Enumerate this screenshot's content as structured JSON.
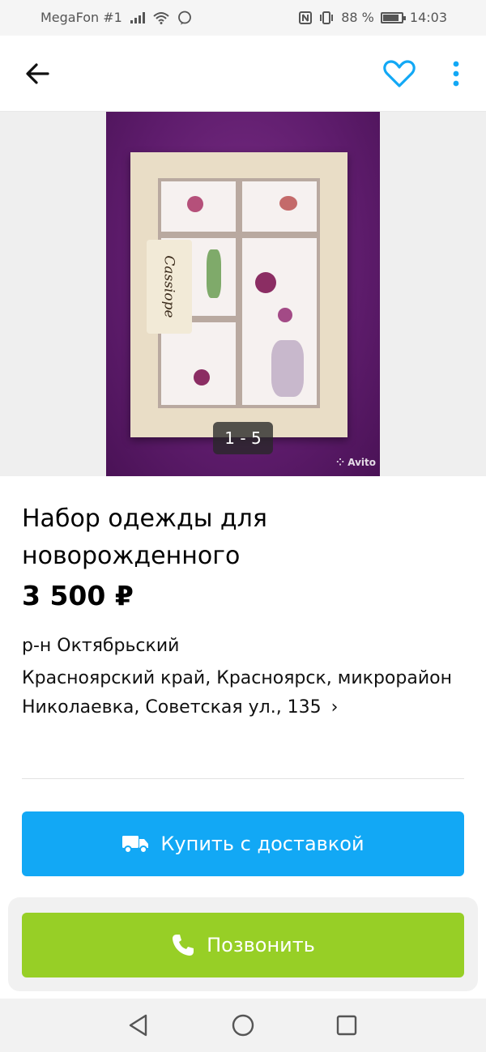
{
  "status_bar": {
    "carrier": "MegaFon #1",
    "battery": "88 %",
    "battery_level": 0.88,
    "time": "14:03"
  },
  "app_bar": {
    "back_icon": "arrow-left-icon",
    "favorite_icon": "heart-outline-icon",
    "more_icon": "vertical-dots-icon",
    "accent_color": "#12a8f5"
  },
  "gallery": {
    "counter": "1 - 5",
    "watermark": "Avito",
    "tag_text": "Cassiope"
  },
  "listing": {
    "title": "Набор одежды для новорожденного",
    "price": "3 500 ₽",
    "district": "р-н Октябрьский",
    "address": "Красноярский край, Красноярск, микрорайон Николаевка, Советская ул., 135"
  },
  "actions": {
    "delivery_label": "Купить с доставкой",
    "delivery_icon": "truck-icon",
    "delivery_color": "#12a8f5",
    "call_label": "Позвонить",
    "call_icon": "phone-icon",
    "call_color": "#97cf26"
  },
  "nav_bar": {
    "back_icon": "triangle-back-icon",
    "home_icon": "circle-home-icon",
    "recent_icon": "square-recent-icon"
  }
}
